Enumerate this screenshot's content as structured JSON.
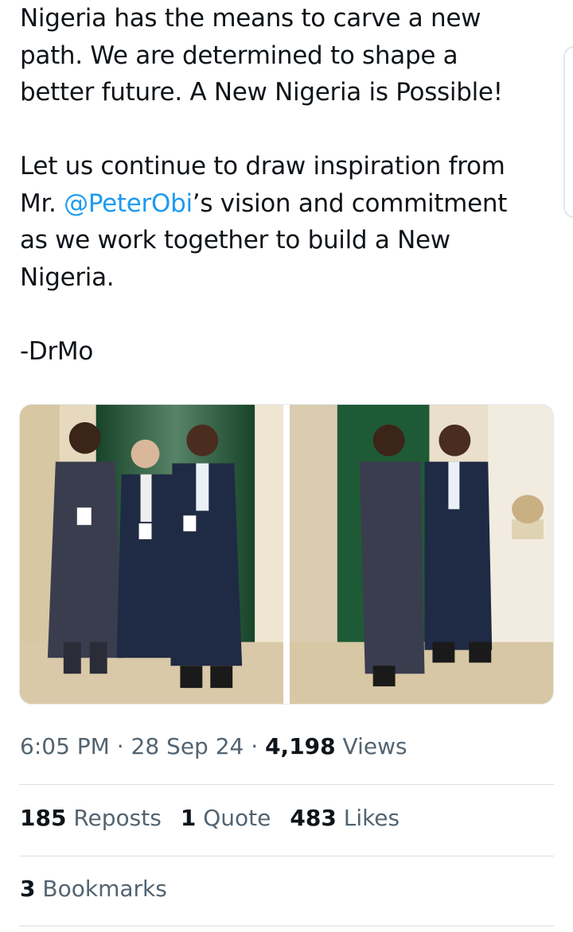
{
  "tweet": {
    "line1": "Nigeria has the means to carve a new",
    "line2": "path. We are determined to shape a",
    "line3": "better future. A New Nigeria is Possible!",
    "line4": "Let us continue to draw inspiration from",
    "line5_prefix": "Mr. ",
    "mention": "@PeterObi",
    "line5_suffix": "’s vision and commitment",
    "line6": "as we work together to build a New",
    "line7": "Nigeria.",
    "signature": "-DrMo"
  },
  "media": {
    "count": 2,
    "colors": {
      "backdrop_green": "#1f5a36",
      "wall": "#e8dcc4",
      "floor": "#d9c9a8",
      "suit_navy": "#1f2a44",
      "kaftan": "#3a3d4e"
    }
  },
  "meta": {
    "time": "6:05 PM",
    "sep1": " · ",
    "date": "28 Sep 24",
    "sep2": " · ",
    "views_count": "4,198",
    "views_label": " Views"
  },
  "stats": {
    "reposts_count": "185",
    "reposts_label": " Reposts",
    "quotes_count": "1",
    "quotes_label": " Quote",
    "likes_count": "483",
    "likes_label": " Likes",
    "bookmarks_count": "3",
    "bookmarks_label": " Bookmarks"
  }
}
